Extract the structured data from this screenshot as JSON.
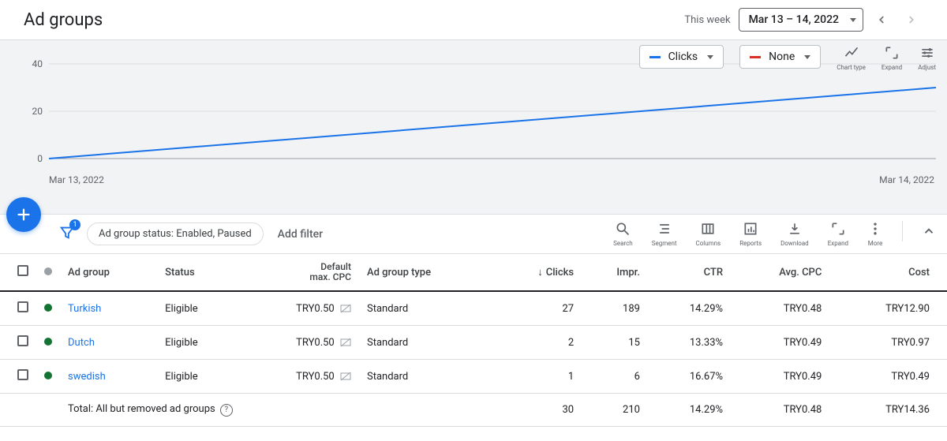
{
  "header": {
    "title": "Ad groups",
    "period_label": "This week",
    "date_range": "Mar 13 – 14, 2022"
  },
  "chart_controls": {
    "series1_label": "Clicks",
    "series1_color": "#1a73e8",
    "series2_label": "None",
    "series2_color": "#d93025",
    "chart_type_label": "Chart type",
    "expand_label": "Expand",
    "adjust_label": "Adjust"
  },
  "chart_data": {
    "type": "line",
    "x": [
      "Mar 13, 2022",
      "Mar 14, 2022"
    ],
    "series": [
      {
        "name": "Clicks",
        "values": [
          0,
          30
        ],
        "color": "#1a73e8"
      }
    ],
    "yticks": [
      0,
      20,
      40
    ],
    "ylim": [
      0,
      40
    ],
    "title": "",
    "xlabel": "",
    "ylabel": ""
  },
  "toolbar": {
    "filter_badge": "1",
    "status_pill": "Ad group status: Enabled, Paused",
    "add_filter": "Add filter",
    "icons": {
      "search": "Search",
      "segment": "Segment",
      "columns": "Columns",
      "reports": "Reports",
      "download": "Download",
      "expand": "Expand",
      "more": "More"
    }
  },
  "table": {
    "headers": {
      "ad_group": "Ad group",
      "status": "Status",
      "default_max_cpc": "Default max. CPC",
      "ad_group_type": "Ad group type",
      "clicks": "Clicks",
      "impr": "Impr.",
      "ctr": "CTR",
      "avg_cpc": "Avg. CPC",
      "cost": "Cost"
    },
    "rows": [
      {
        "name": "Turkish",
        "status": "Eligible",
        "cpc": "TRY0.50",
        "type": "Standard",
        "clicks": "27",
        "impr": "189",
        "ctr": "14.29%",
        "avg_cpc": "TRY0.48",
        "cost": "TRY12.90"
      },
      {
        "name": "Dutch",
        "status": "Eligible",
        "cpc": "TRY0.50",
        "type": "Standard",
        "clicks": "2",
        "impr": "15",
        "ctr": "13.33%",
        "avg_cpc": "TRY0.49",
        "cost": "TRY0.97"
      },
      {
        "name": "swedish",
        "status": "Eligible",
        "cpc": "TRY0.50",
        "type": "Standard",
        "clicks": "1",
        "impr": "6",
        "ctr": "16.67%",
        "avg_cpc": "TRY0.49",
        "cost": "TRY0.49"
      }
    ],
    "total": {
      "label": "Total: All but removed ad groups",
      "clicks": "30",
      "impr": "210",
      "ctr": "14.29%",
      "avg_cpc": "TRY0.48",
      "cost": "TRY14.36"
    }
  }
}
